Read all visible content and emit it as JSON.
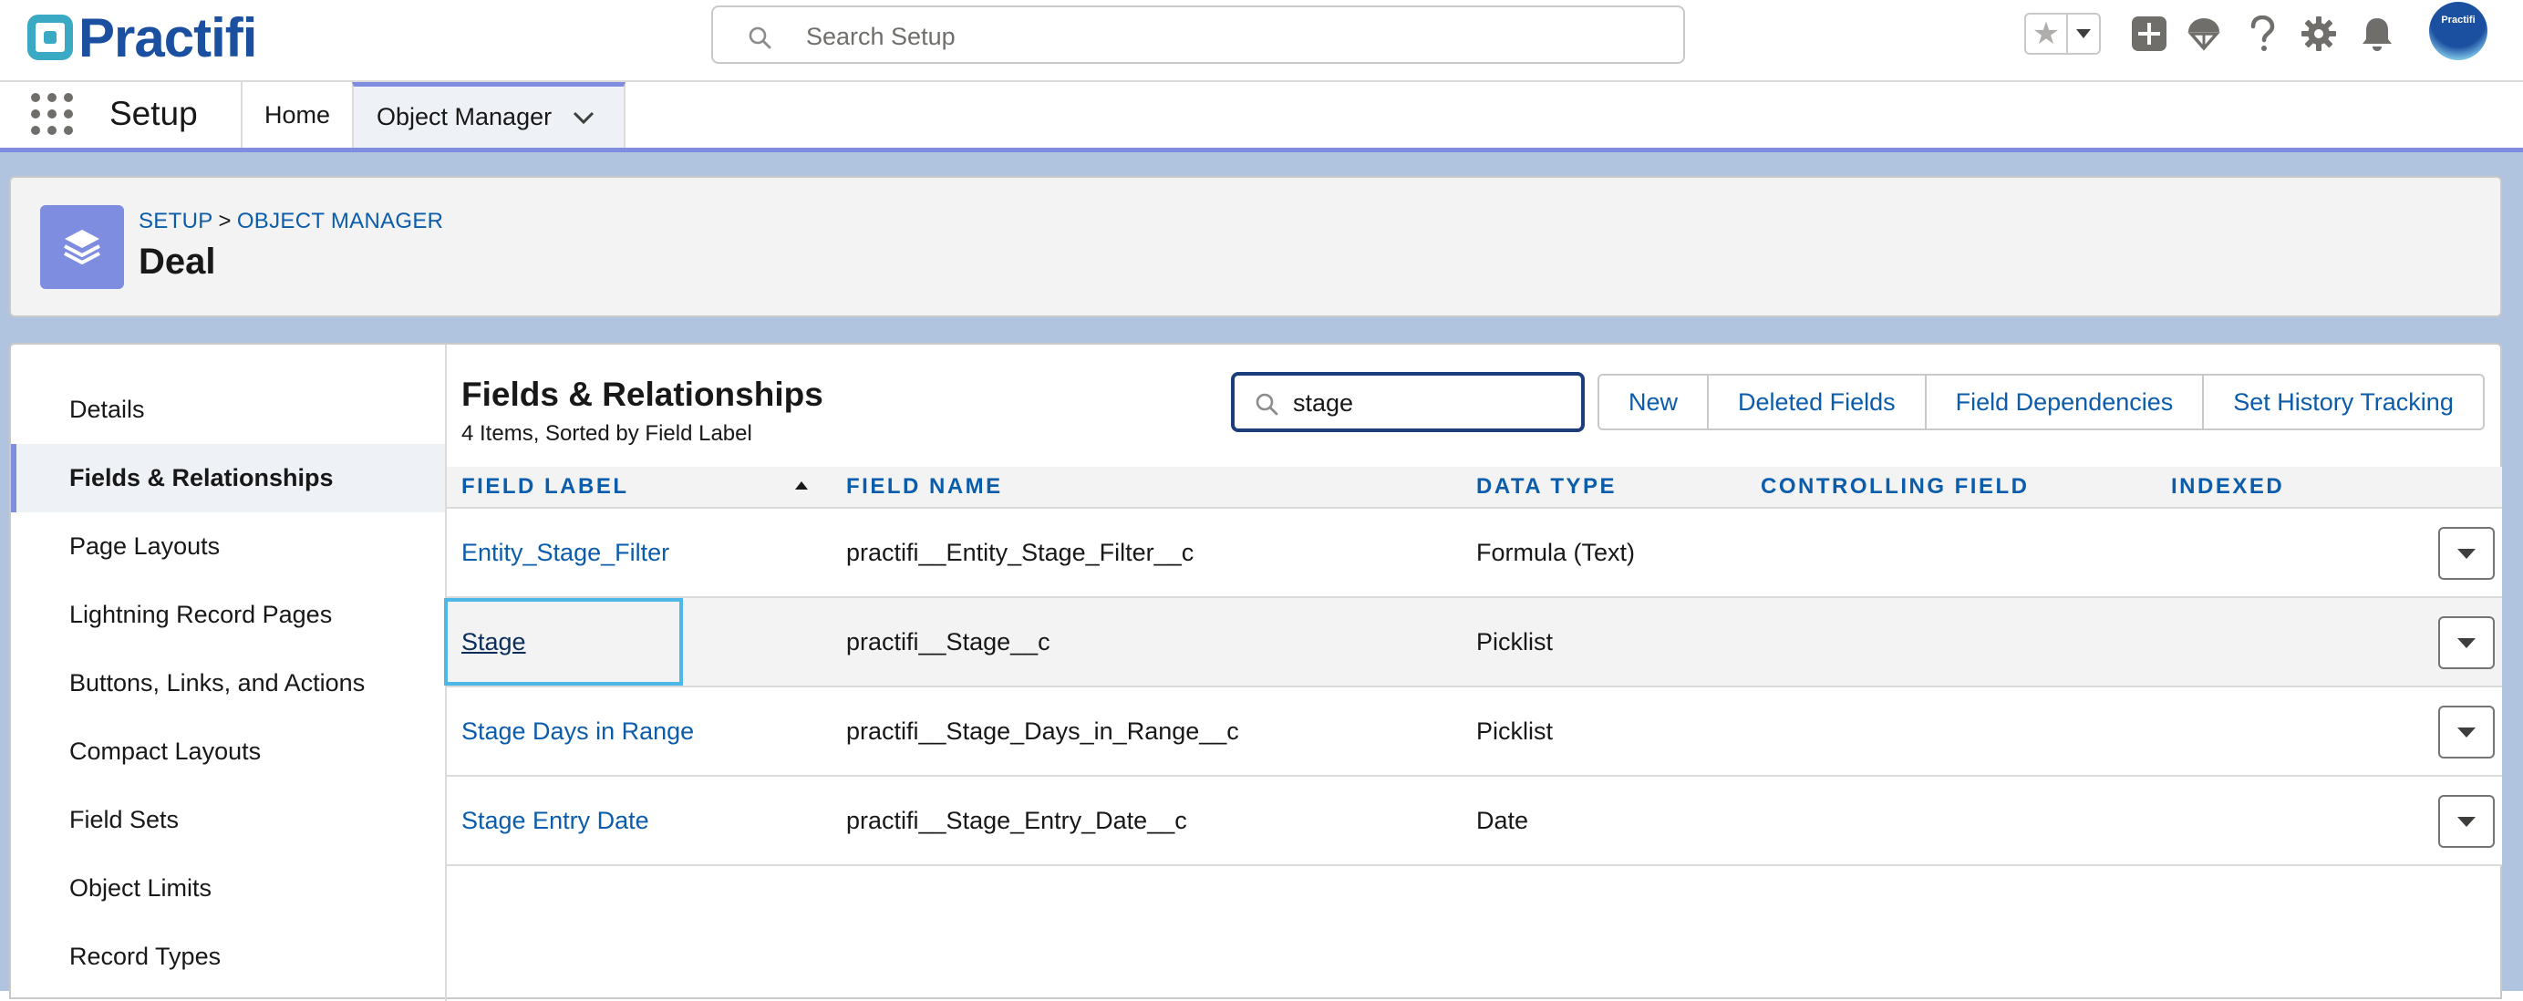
{
  "brand": {
    "logo_text": "Practifi"
  },
  "global_search": {
    "placeholder": "Search Setup"
  },
  "avatar": {
    "text": "Practifi"
  },
  "nav": {
    "app_name": "Setup",
    "tabs": [
      {
        "label": "Home"
      },
      {
        "label": "Object Manager"
      }
    ]
  },
  "header": {
    "breadcrumb": [
      "SETUP",
      "OBJECT MANAGER"
    ],
    "breadcrumb_sep": ">",
    "title": "Deal"
  },
  "sidebar": {
    "items": [
      {
        "label": "Details"
      },
      {
        "label": "Fields & Relationships"
      },
      {
        "label": "Page Layouts"
      },
      {
        "label": "Lightning Record Pages"
      },
      {
        "label": "Buttons, Links, and Actions"
      },
      {
        "label": "Compact Layouts"
      },
      {
        "label": "Field Sets"
      },
      {
        "label": "Object Limits"
      },
      {
        "label": "Record Types"
      }
    ]
  },
  "main": {
    "title": "Fields & Relationships",
    "subtitle": "4 Items, Sorted by Field Label",
    "quick_find_value": "stage",
    "buttons": [
      {
        "label": "New"
      },
      {
        "label": "Deleted Fields"
      },
      {
        "label": "Field Dependencies"
      },
      {
        "label": "Set History Tracking"
      }
    ],
    "columns": [
      {
        "label": "FIELD LABEL"
      },
      {
        "label": "FIELD NAME"
      },
      {
        "label": "DATA TYPE"
      },
      {
        "label": "CONTROLLING FIELD"
      },
      {
        "label": "INDEXED"
      }
    ],
    "rows": [
      {
        "label": "Entity_Stage_Filter",
        "name": "practifi__Entity_Stage_Filter__c",
        "type": "Formula (Text)",
        "controlling": "",
        "indexed": ""
      },
      {
        "label": "Stage",
        "name": "practifi__Stage__c",
        "type": "Picklist",
        "controlling": "",
        "indexed": ""
      },
      {
        "label": "Stage Days in Range",
        "name": "practifi__Stage_Days_in_Range__c",
        "type": "Picklist",
        "controlling": "",
        "indexed": ""
      },
      {
        "label": "Stage Entry Date",
        "name": "practifi__Stage_Entry_Date__c",
        "type": "Date",
        "controlling": "",
        "indexed": ""
      }
    ]
  },
  "colors": {
    "accent": "#7f8de1",
    "link": "#0b5cab",
    "brand_blue": "#1b4fa0",
    "focus": "#4db8e8"
  }
}
